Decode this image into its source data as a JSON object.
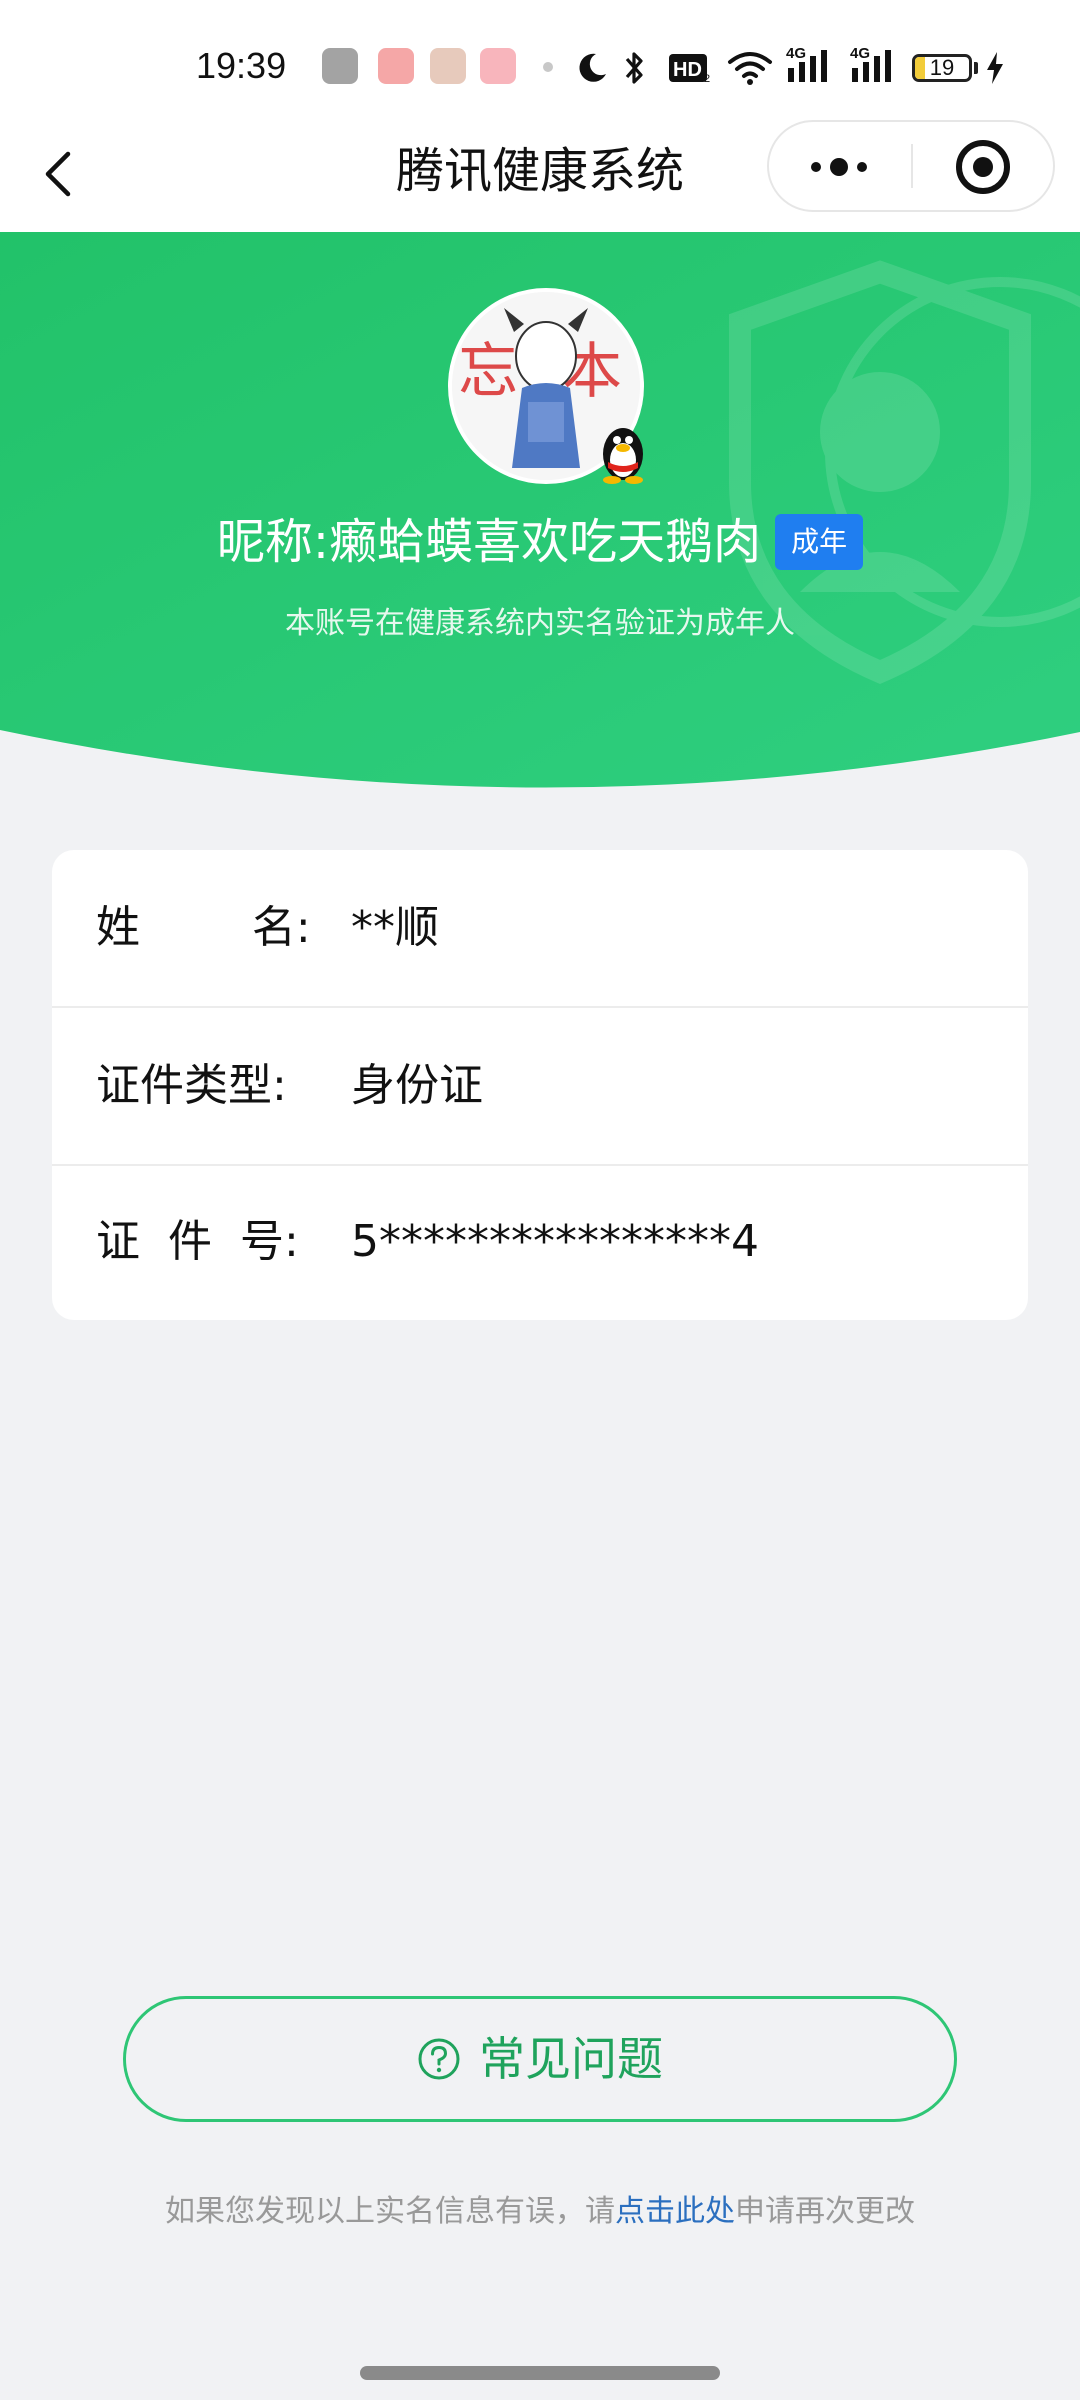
{
  "status_bar": {
    "time": "19:39",
    "battery_level": "19",
    "battery_fraction": 0.19,
    "icons": [
      "douyin-icon",
      "toutiao-icon",
      "bilibili-icon",
      "video-icon",
      "moon-icon",
      "bluetooth-icon",
      "hd-icon",
      "wifi-icon",
      "signal-4g-icon",
      "signal-4g-icon",
      "battery-icon",
      "charging-icon"
    ]
  },
  "nav": {
    "title": "腾讯健康系统",
    "back_icon": "chevron-left-icon",
    "more_icon": "more-dots-icon",
    "close_icon": "target-circle-icon"
  },
  "profile": {
    "nickname_prefix": "昵称: ",
    "nickname": "癞蛤蟆喜欢吃天鹅肉",
    "age_badge": "成年",
    "verify_note": "本账号在健康系统内实名验证为成年人"
  },
  "info": {
    "rows": [
      {
        "label": "姓        名:",
        "value": "**顺"
      },
      {
        "label": "证件类型:",
        "value": "身份证"
      },
      {
        "label": "证  件  号:",
        "value": "5****************4"
      }
    ]
  },
  "faq": {
    "label": "常见问题",
    "icon": "help-circle-icon"
  },
  "footer": {
    "prefix": "如果您发现以上实名信息有误，请",
    "link": "点击此处",
    "suffix": "申请再次更改"
  },
  "colors": {
    "banner_green": "#25c46c",
    "accent_blue": "#1f7ef0",
    "faq_green": "#1fa35c",
    "link_blue": "#2b6fbf",
    "page_bg": "#f1f2f4"
  }
}
